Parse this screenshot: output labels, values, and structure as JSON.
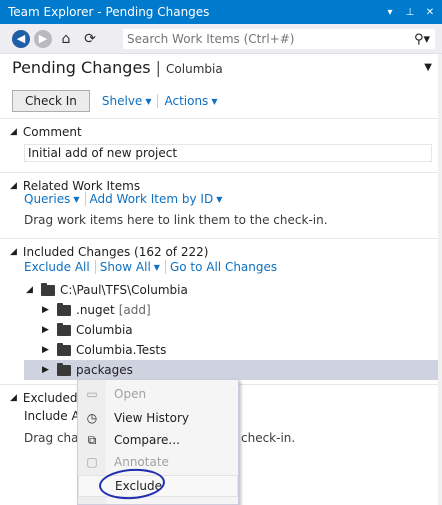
{
  "window": {
    "title": "Team Explorer - Pending Changes",
    "dropdown_glyph": "▾",
    "pin_glyph": "📌",
    "close_glyph": "✕"
  },
  "toolbar": {
    "search_placeholder": "Search Work Items (Ctrl+#)",
    "search_icon": "⚲",
    "search_dropdown": "▾"
  },
  "header": {
    "title": "Pending Changes",
    "separator": "|",
    "subtitle": "Columbia"
  },
  "actions": {
    "checkin_label": "Check In",
    "shelve_label": "Shelve",
    "actions_label": "Actions"
  },
  "comment": {
    "title": "Comment",
    "value": "Initial add of new project"
  },
  "related": {
    "title": "Related Work Items",
    "queries_label": "Queries",
    "add_label": "Add Work Item by ID",
    "hint": "Drag work items here to link them to the check-in."
  },
  "included": {
    "title": "Included Changes (162 of 222)",
    "exclude_all": "Exclude All",
    "show_all": "Show All",
    "go_to_all": "Go to All Changes",
    "tree": [
      {
        "label": "C:\\Paul\\TFS\\Columbia",
        "tag": ""
      },
      {
        "label": ".nuget",
        "tag": "[add]"
      },
      {
        "label": "Columbia",
        "tag": ""
      },
      {
        "label": "Columbia.Tests",
        "tag": ""
      },
      {
        "label": "packages",
        "tag": ""
      }
    ]
  },
  "excluded": {
    "title_partial": "Excluded C",
    "include_partial": "Include Al",
    "hint_left": "Drag chan",
    "hint_right": "check-in."
  },
  "context_menu": {
    "items": [
      {
        "label": "Open",
        "icon": "folder-open-icon",
        "enabled": false
      },
      {
        "label": "View History",
        "icon": "history-icon",
        "enabled": true
      },
      {
        "label": "Compare...",
        "icon": "compare-icon",
        "enabled": true
      },
      {
        "label": "Annotate",
        "icon": "annotate-icon",
        "enabled": false
      },
      {
        "label": "Exclude",
        "icon": "",
        "enabled": true
      }
    ]
  },
  "colors": {
    "accent": "#007acc",
    "link": "#0e70c0",
    "selection": "#cfd3e0",
    "annotation_circle": "#1f2fb0"
  }
}
